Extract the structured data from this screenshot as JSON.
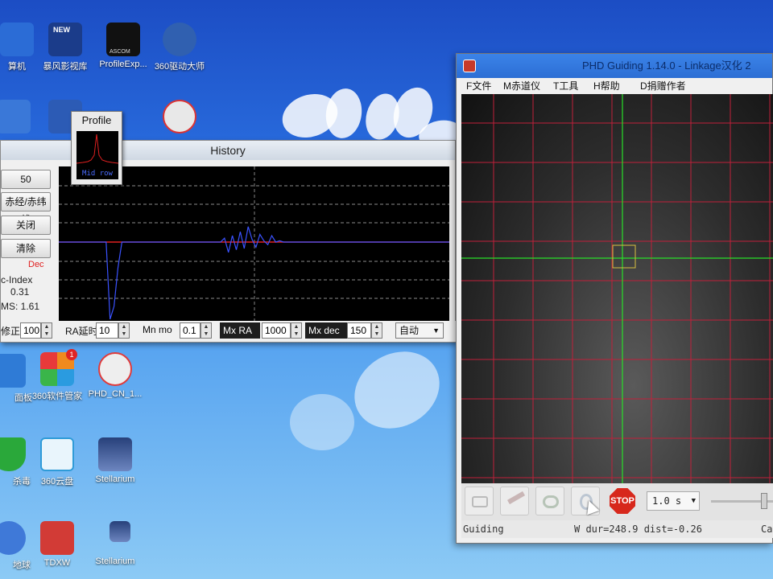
{
  "desktop": {
    "icons": [
      {
        "label": "算机",
        "name": "desktop-icon-computer",
        "icon": "monitor-icon",
        "color": "#2b6cd6"
      },
      {
        "label": "暴风影视库",
        "name": "desktop-icon-baofeng",
        "icon": "new-badge-icon",
        "color": "#1b3c8a",
        "badge": "NEW"
      },
      {
        "label": "ProfileExp...",
        "name": "desktop-icon-profileexp",
        "icon": "constellation-icon",
        "color": "#111111",
        "badge": "ASCOM"
      },
      {
        "label": "360驱动大师",
        "name": "desktop-icon-360driver",
        "icon": "gear-icon",
        "color": "#3060b0"
      },
      {
        "label": "面板",
        "name": "desktop-icon-control-panel",
        "icon": "panel-icon",
        "color": "#2f7bd6"
      },
      {
        "label": "360软件管家",
        "name": "desktop-icon-360soft",
        "icon": "tiles-icon",
        "color": "#f08a1e",
        "badge": "1"
      },
      {
        "label": "PHD_CN_1...",
        "name": "desktop-icon-phd",
        "icon": "phd-icon",
        "color": "#e03b3b"
      },
      {
        "label": "杀毒",
        "name": "desktop-icon-antivirus",
        "icon": "shield-icon",
        "color": "#2aa83a"
      },
      {
        "label": "360云盘",
        "name": "desktop-icon-360cloud",
        "icon": "cloud-icon",
        "color": "#2f9bd8"
      },
      {
        "label": "Stellarium",
        "name": "desktop-icon-stellarium",
        "icon": "moon-icon",
        "color": "#27407a"
      },
      {
        "label": "地球",
        "name": "desktop-icon-earth",
        "icon": "globe-icon",
        "color": "#3f79d8"
      },
      {
        "label": "TDXW",
        "name": "desktop-icon-tdxw",
        "icon": "tdx-icon",
        "color": "#d23b36"
      },
      {
        "label": "Stellarium",
        "name": "desktop-icon-stellarium-2",
        "icon": "moon-icon",
        "color": "#27407a"
      }
    ]
  },
  "history": {
    "title": "History",
    "buttons": [
      "50",
      "赤经/赤纬线",
      "关闭",
      "清除"
    ],
    "dec_legend": "Dec",
    "osc_label": "c-Index",
    "osc_value": "0.31",
    "rms_label": "MS: 1.61",
    "graph_colors": {
      "ra": "#3a52ff",
      "dec": "#e02020"
    },
    "ra_trace": [
      0,
      0,
      0,
      0,
      0,
      0,
      0,
      0,
      0,
      0,
      0,
      0,
      0,
      -6,
      -5,
      -2,
      0,
      0,
      0,
      0,
      0,
      0,
      0,
      0,
      0,
      0,
      0,
      0,
      0,
      0,
      0,
      0,
      0,
      0,
      0,
      0,
      0,
      0,
      0,
      0,
      0,
      0,
      0.3,
      -0.8,
      0.5,
      -0.6,
      0.8,
      -0.5,
      1.2,
      0.2,
      -0.4,
      0.6,
      0.1,
      -0.2,
      0.5,
      0,
      0.1,
      0,
      0,
      0,
      0,
      0,
      0,
      0,
      0,
      0,
      0,
      0,
      0,
      0,
      0,
      0,
      0,
      0,
      0,
      0,
      0,
      0,
      0,
      0,
      0,
      0,
      0,
      0,
      0,
      0,
      0,
      0,
      0,
      0,
      0,
      0,
      0,
      0,
      0,
      0,
      0,
      0,
      0,
      0
    ],
    "dec_trace": [
      0,
      0,
      0,
      0,
      0,
      0,
      0,
      0,
      0,
      0,
      0,
      0,
      0,
      0,
      0,
      0,
      0,
      0,
      0,
      0,
      0,
      0,
      0,
      0,
      0,
      0,
      0,
      0,
      0,
      0,
      0,
      0,
      0,
      0,
      0,
      0,
      0,
      0,
      0,
      0,
      0,
      0,
      0,
      0,
      0,
      0,
      0,
      0,
      0,
      0,
      0,
      0,
      0,
      0,
      0,
      0,
      0,
      0,
      0,
      0,
      0,
      0,
      0,
      0,
      0,
      0,
      0,
      0,
      0,
      0,
      0,
      0,
      0,
      0,
      0,
      0,
      0,
      0,
      0,
      0,
      0,
      0,
      0,
      0,
      0,
      0,
      0,
      0,
      0,
      0,
      0,
      0,
      0,
      0,
      0,
      0,
      0,
      0,
      0,
      0
    ],
    "bottom": {
      "fix_label": "修正",
      "fix_value": "100",
      "ra_delay_label": "RA延时",
      "ra_delay_value": "10",
      "mn_mo_label": "Mn mo",
      "mn_mo_value": "0.1",
      "mx_ra_label": "Mx RA",
      "mx_ra_value": "1000",
      "mx_dec_label": "Mx dec",
      "mx_dec_value": "150",
      "mode_value": "自动"
    }
  },
  "profile": {
    "title": "Profile",
    "caption": "Mid row"
  },
  "phd": {
    "title": "PHD Guiding 1.14.0  - Linkage汉化 2",
    "menu": [
      "F文件",
      "M赤道仪",
      "T工具",
      "H帮助",
      "D捐赠作者"
    ],
    "grid_color": "#c0203a",
    "crosshair_color": "#28e028",
    "toolbar": {
      "camera_icon": "camera-icon",
      "scope_icon": "telescope-icon",
      "loop_icon": "loop-icon",
      "guide_icon": "guide-icon",
      "stop_label": "STOP",
      "exposure": "1.0 s"
    },
    "status": {
      "left": "Guiding",
      "right": "W dur=248.9 dist=-0.26",
      "tail": "Ca"
    }
  }
}
